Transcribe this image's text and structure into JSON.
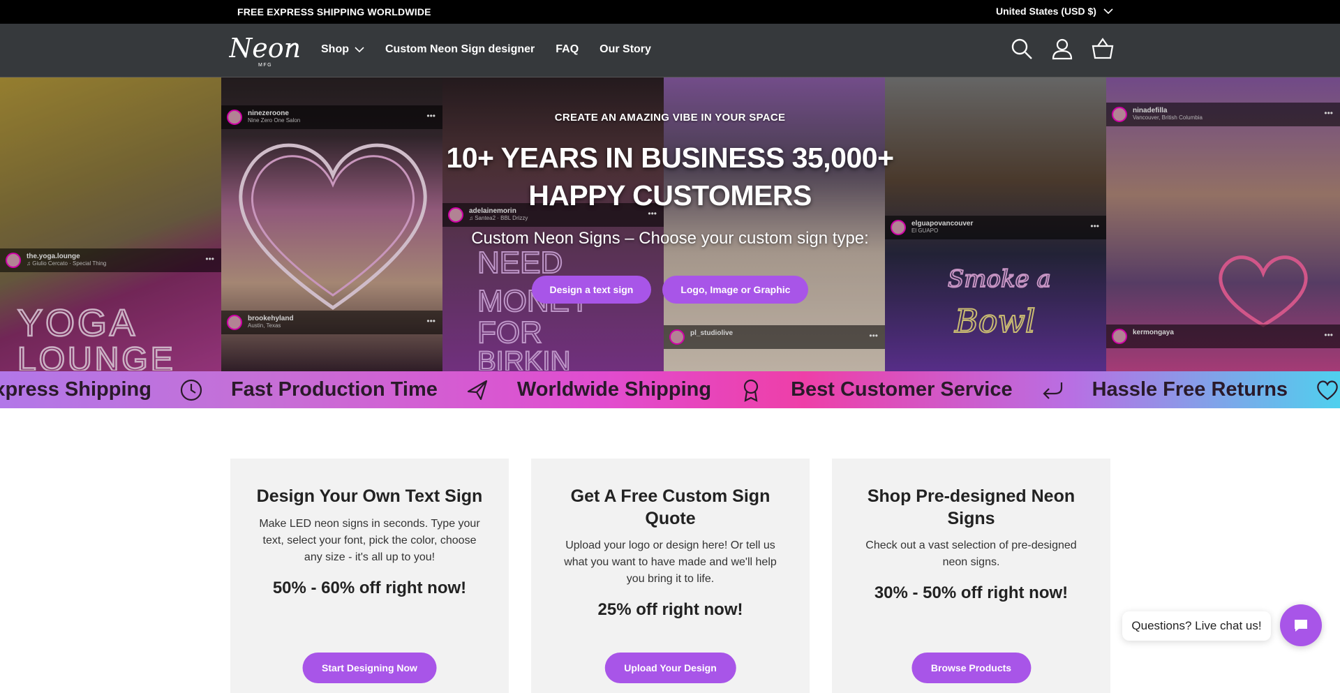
{
  "announcement": {
    "shipping": "FREE EXPRESS SHIPPING WORLDWIDE",
    "country": "United States (USD $)"
  },
  "header": {
    "logo_text": "Neon",
    "logo_sub": "MFG",
    "nav": [
      {
        "label": "Shop"
      },
      {
        "label": "Custom Neon Sign designer"
      },
      {
        "label": "FAQ"
      },
      {
        "label": "Our Story"
      }
    ],
    "icons": [
      "search-icon",
      "account-icon",
      "cart-icon"
    ]
  },
  "hero": {
    "eyebrow": "CREATE AN AMAZING VIBE IN YOUR SPACE",
    "headline": "10+ YEARS IN BUSINESS 35,000+ HAPPY CUSTOMERS",
    "subline": "Custom Neon Signs – Choose your custom sign type:",
    "buttons": [
      "Design a text sign",
      "Logo, Image or Graphic"
    ],
    "posts": [
      {
        "user": "the.yoga.lounge",
        "sub": "♫ Giulio Cercato · Special Thing",
        "neon": "THE YOGA LOUNGE"
      },
      {
        "user": "ninezeroone",
        "sub": "Nine Zero One Salon"
      },
      {
        "user": "brookehyland",
        "sub": "Austin, Texas"
      },
      {
        "user": "adelainemorin",
        "sub": "♫ Santea2 · BBL Drizzy",
        "neon": "NEED MONEY FOR BIRKIN"
      },
      {
        "user": "pl_studiolive",
        "sub": ""
      },
      {
        "user": "elguapovancouver",
        "sub": "El GUAPO",
        "neon": "Smoke a Bowl"
      },
      {
        "user": "ninadefilla",
        "sub": "Vancouver, British Columbia"
      },
      {
        "user": "kermongaya",
        "sub": ""
      }
    ]
  },
  "marquee": [
    {
      "label": "Express Shipping",
      "icon": "clock-icon"
    },
    {
      "label": "Fast Production Time",
      "icon": "plane-icon"
    },
    {
      "label": "Worldwide Shipping",
      "icon": "award-icon"
    },
    {
      "label": "Best Customer Service",
      "icon": "return-arrow-icon"
    },
    {
      "label": "Hassle Free Returns",
      "icon": "heart-icon"
    }
  ],
  "cards": [
    {
      "title": "Design Your Own Text Sign",
      "desc": "Make LED neon signs in seconds. Type your text, select your font, pick the color, choose any size - it's all up to you!",
      "offer": "50% - 60% off right now!",
      "button": "Start Designing Now"
    },
    {
      "title": "Get A Free Custom Sign Quote",
      "desc": "Upload your logo or design here! Or tell us what you want to have made and we'll help you bring it to life.",
      "offer": "25% off right now!",
      "button": "Upload Your Design"
    },
    {
      "title": "Shop Pre-designed Neon Signs",
      "desc": "Check out a vast selection of pre-designed neon signs.",
      "offer": "30% - 50% off right now!",
      "button": "Browse Products"
    }
  ],
  "chat": {
    "label": "Questions? Live chat us!"
  },
  "colors": {
    "accent": "#a855e8",
    "header_bg": "#36393c",
    "announce_bg": "#000000"
  }
}
